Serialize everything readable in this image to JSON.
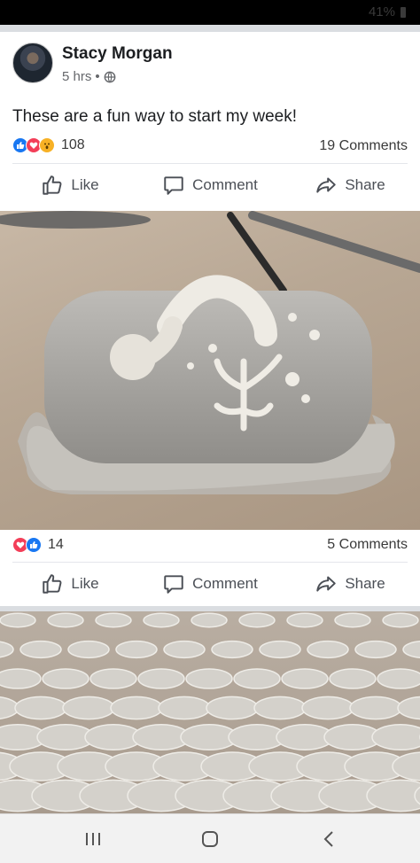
{
  "status_bar": {
    "battery_text": "41%"
  },
  "post1": {
    "author": "Stacy Morgan",
    "time": "5 hrs",
    "separator": "•",
    "text": "These are a fun way to start my week!",
    "reaction_count": "108",
    "comments": "19 Comments"
  },
  "post2": {
    "reaction_count": "14",
    "comments": "5 Comments"
  },
  "actions": {
    "like": "Like",
    "comment": "Comment",
    "share": "Share"
  },
  "icons": {
    "like": "thumbs-up-icon",
    "comment": "speech-bubble-icon",
    "share": "share-arrow-icon",
    "privacy": "globe-icon",
    "nav_recent": "recent-apps-icon",
    "nav_home": "home-icon",
    "nav_back": "back-icon"
  },
  "images": {
    "photo1": "Ceramic butter dish with octopus tentacle and coral relief",
    "photo2": "Rows of small round ceramic dishes with coral relief"
  },
  "colors": {
    "accent": "#1877f2",
    "love": "#f33e58",
    "wow": "#f7b125",
    "text_secondary": "#65676b"
  }
}
